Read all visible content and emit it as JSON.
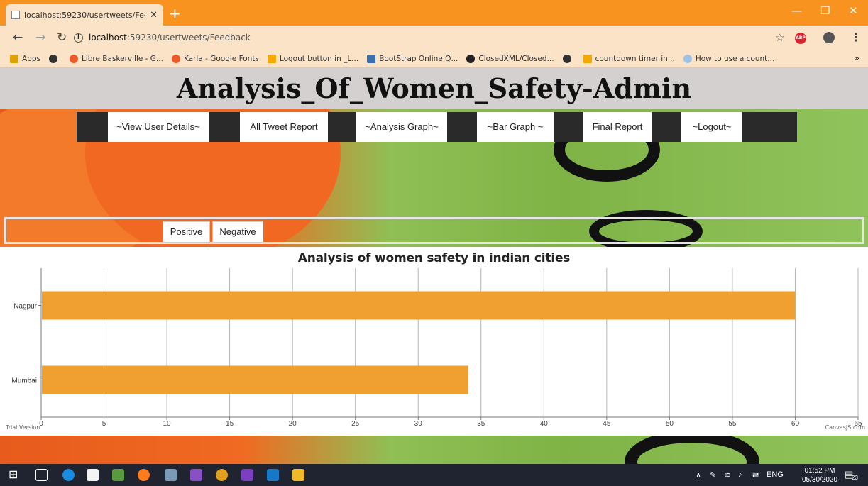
{
  "browser": {
    "tab_title": "localhost:59230/usertweets/Feed",
    "new_tab": "+",
    "url_host": "localhost",
    "url_rest": ":59230/usertweets/Feedback",
    "bookmarks": [
      {
        "label": "Apps",
        "color": "#e0a000"
      },
      {
        "label": "",
        "color": "#333333"
      },
      {
        "label": "Libre Baskerville - G...",
        "color": "#f05a28"
      },
      {
        "label": "Karla - Google Fonts",
        "color": "#f05a28"
      },
      {
        "label": "Logout button in _L...",
        "color": "#f7a800"
      },
      {
        "label": "BootStrap Online Q...",
        "color": "#3a6fb0"
      },
      {
        "label": "ClosedXML/Closed...",
        "color": "#222222"
      },
      {
        "label": "",
        "color": "#333333"
      },
      {
        "label": "countdown timer in...",
        "color": "#f7a800"
      },
      {
        "label": "How to use a count...",
        "color": "#9cc3e6"
      }
    ],
    "more": "»"
  },
  "header": {
    "title": "Analysis_Of_Women_Safety-Admin"
  },
  "nav": [
    {
      "label": "~View User Details~"
    },
    {
      "label": "All Tweet Report"
    },
    {
      "label": "~Analysis Graph~"
    },
    {
      "label": "~Bar Graph ~"
    },
    {
      "label": "Final Report"
    },
    {
      "label": "~Logout~"
    }
  ],
  "filters": {
    "positive": "Positive",
    "negative": "Negative"
  },
  "chart_data": {
    "type": "bar",
    "orientation": "horizontal",
    "title": "Analysis of women safety in indian cities",
    "categories": [
      "Nagpur",
      "Mumbai"
    ],
    "values": [
      60,
      34
    ],
    "xlim": [
      0,
      65
    ],
    "ticks": [
      0,
      5,
      10,
      15,
      20,
      25,
      30,
      35,
      40,
      45,
      50,
      55,
      60,
      65
    ],
    "bar_color": "#f0a030",
    "grid": true
  },
  "chart_footer": {
    "left": "Trial Version",
    "right": "CanvasJS.com"
  },
  "taskbar": {
    "lang": "ENG",
    "time": "01:52 PM",
    "date": "05/30/2020",
    "notifications": "23"
  }
}
